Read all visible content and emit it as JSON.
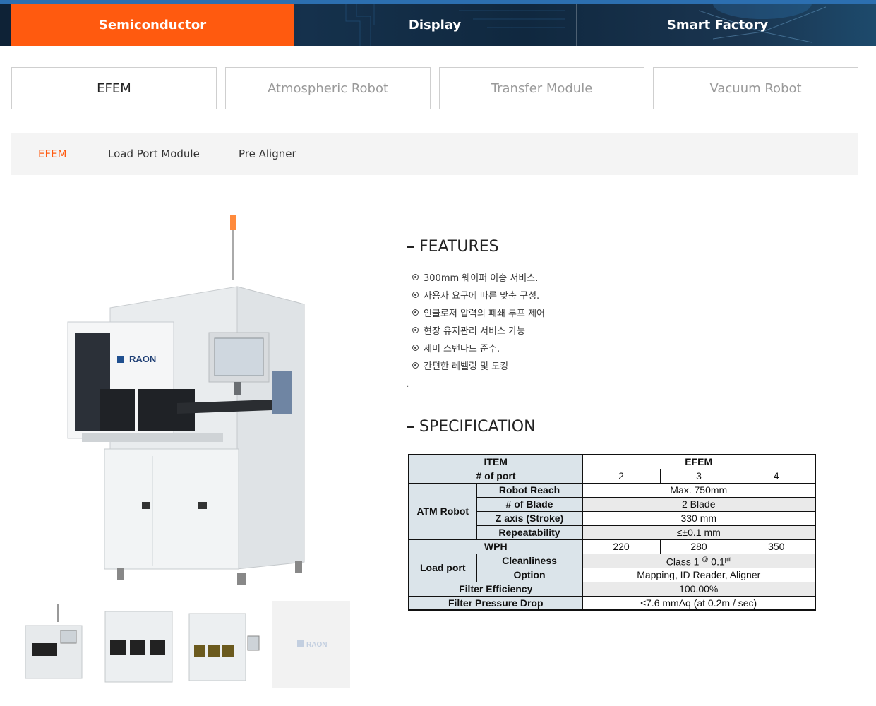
{
  "categories": [
    {
      "label": "Semiconductor",
      "active": true
    },
    {
      "label": "Display",
      "active": false
    },
    {
      "label": "Smart Factory",
      "active": false
    }
  ],
  "product_tabs": [
    {
      "label": "EFEM",
      "active": true
    },
    {
      "label": "Atmospheric Robot",
      "active": false
    },
    {
      "label": "Transfer Module",
      "active": false
    },
    {
      "label": "Vacuum Robot",
      "active": false
    }
  ],
  "sub_nav": [
    {
      "label": "EFEM",
      "active": true
    },
    {
      "label": "Load Port Module",
      "active": false
    },
    {
      "label": "Pre Aligner",
      "active": false
    }
  ],
  "product": {
    "brand": "RAON",
    "features_title": "FEATURES",
    "features": [
      "300mm 웨이퍼 이송 서비스.",
      "사용자 요구에 따른 맞춤 구성.",
      "인클로저 압력의 폐쇄 루프 제어",
      "현장 유지관리 서비스 가능",
      "세미 스탠다드 준수.",
      "간편한 레벨링 및 도킹"
    ],
    "note": ".",
    "spec_title": "SPECIFICATION"
  },
  "spec": {
    "item": "ITEM",
    "model": "EFEM",
    "port_label": "# of port",
    "ports": [
      "2",
      "3",
      "4"
    ],
    "atm_robot": "ATM Robot",
    "robot_reach_label": "Robot Reach",
    "robot_reach": "Max. 750mm",
    "blade_label": "# of Blade",
    "blade": "2 Blade",
    "z_label": "Z axis (Stroke)",
    "z": "330 mm",
    "rep_label": "Repeatability",
    "rep": "≤±0.1 mm",
    "wph_label": "WPH",
    "wph": [
      "220",
      "280",
      "350"
    ],
    "load_port": "Load port",
    "clean_label": "Cleanliness",
    "clean_main": "Class 1 ",
    "clean_sup1": "@",
    "clean_mid": " 0.1",
    "clean_sup2": "㎛",
    "option_label": "Option",
    "option": "Mapping, ID Reader, Aligner",
    "filter_eff_label": "Filter Efficiency",
    "filter_eff": "100.00%",
    "filter_drop_label": "Filter Pressure Drop",
    "filter_drop": "≤7.6 mmAq (at 0.2m /  sec)"
  }
}
